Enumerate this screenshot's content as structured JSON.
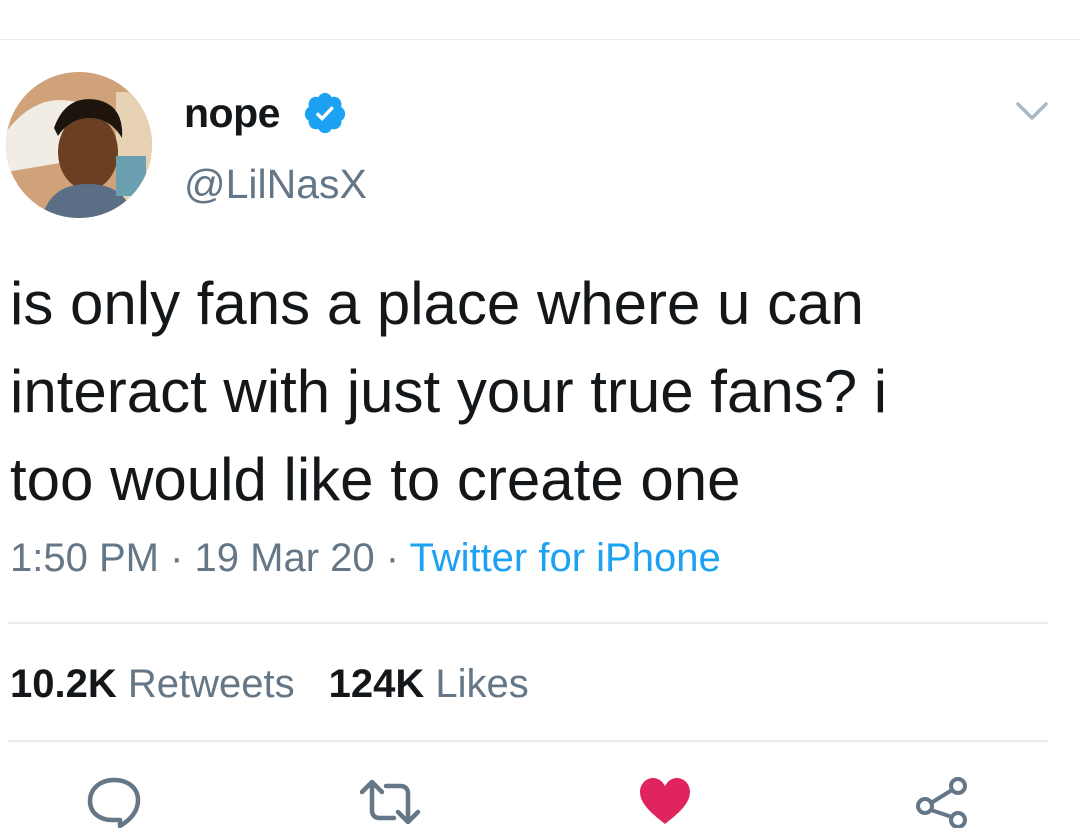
{
  "tweet": {
    "display_name": "nope",
    "handle": "@LilNasX",
    "verified": true,
    "text": "is only fans a place where u can\ninteract with just your true fans? i\ntoo would like to create one",
    "time": "1:50 PM",
    "date": "19 Mar 20",
    "separator": " · ",
    "source": "Twitter for iPhone",
    "retweets_count": "10.2K",
    "retweets_label": "Retweets",
    "likes_count": "124K",
    "likes_label": "Likes"
  },
  "icons": {
    "verified": "verified-badge-icon",
    "menu": "chevron-down-icon",
    "reply": "reply-icon",
    "retweet": "retweet-icon",
    "like": "heart-icon",
    "share": "share-icon"
  },
  "colors": {
    "text": "#14171a",
    "secondary": "#657786",
    "link": "#1da1f2",
    "like_active": "#e0245e",
    "divider": "#e6ecf0"
  }
}
